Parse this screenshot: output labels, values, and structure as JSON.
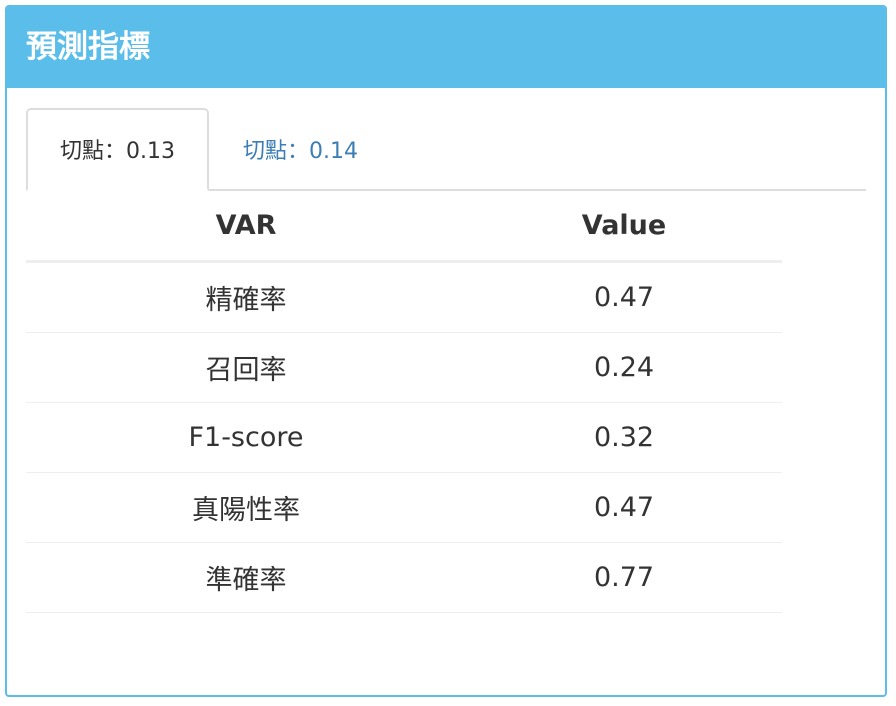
{
  "panel": {
    "title": "預測指標"
  },
  "tabs": [
    {
      "label": "切點：0.13",
      "active": true
    },
    {
      "label": "切點：0.14",
      "active": false
    }
  ],
  "table": {
    "headers": [
      "VAR",
      "Value"
    ],
    "rows": [
      {
        "var": "精確率",
        "value": "0.47"
      },
      {
        "var": "召回率",
        "value": "0.24"
      },
      {
        "var": "F1-score",
        "value": "0.32"
      },
      {
        "var": "真陽性率",
        "value": "0.47"
      },
      {
        "var": "準確率",
        "value": "0.77"
      }
    ]
  },
  "colors": {
    "header_bg": "#5bbdea",
    "tab_link": "#3c7eb5"
  }
}
